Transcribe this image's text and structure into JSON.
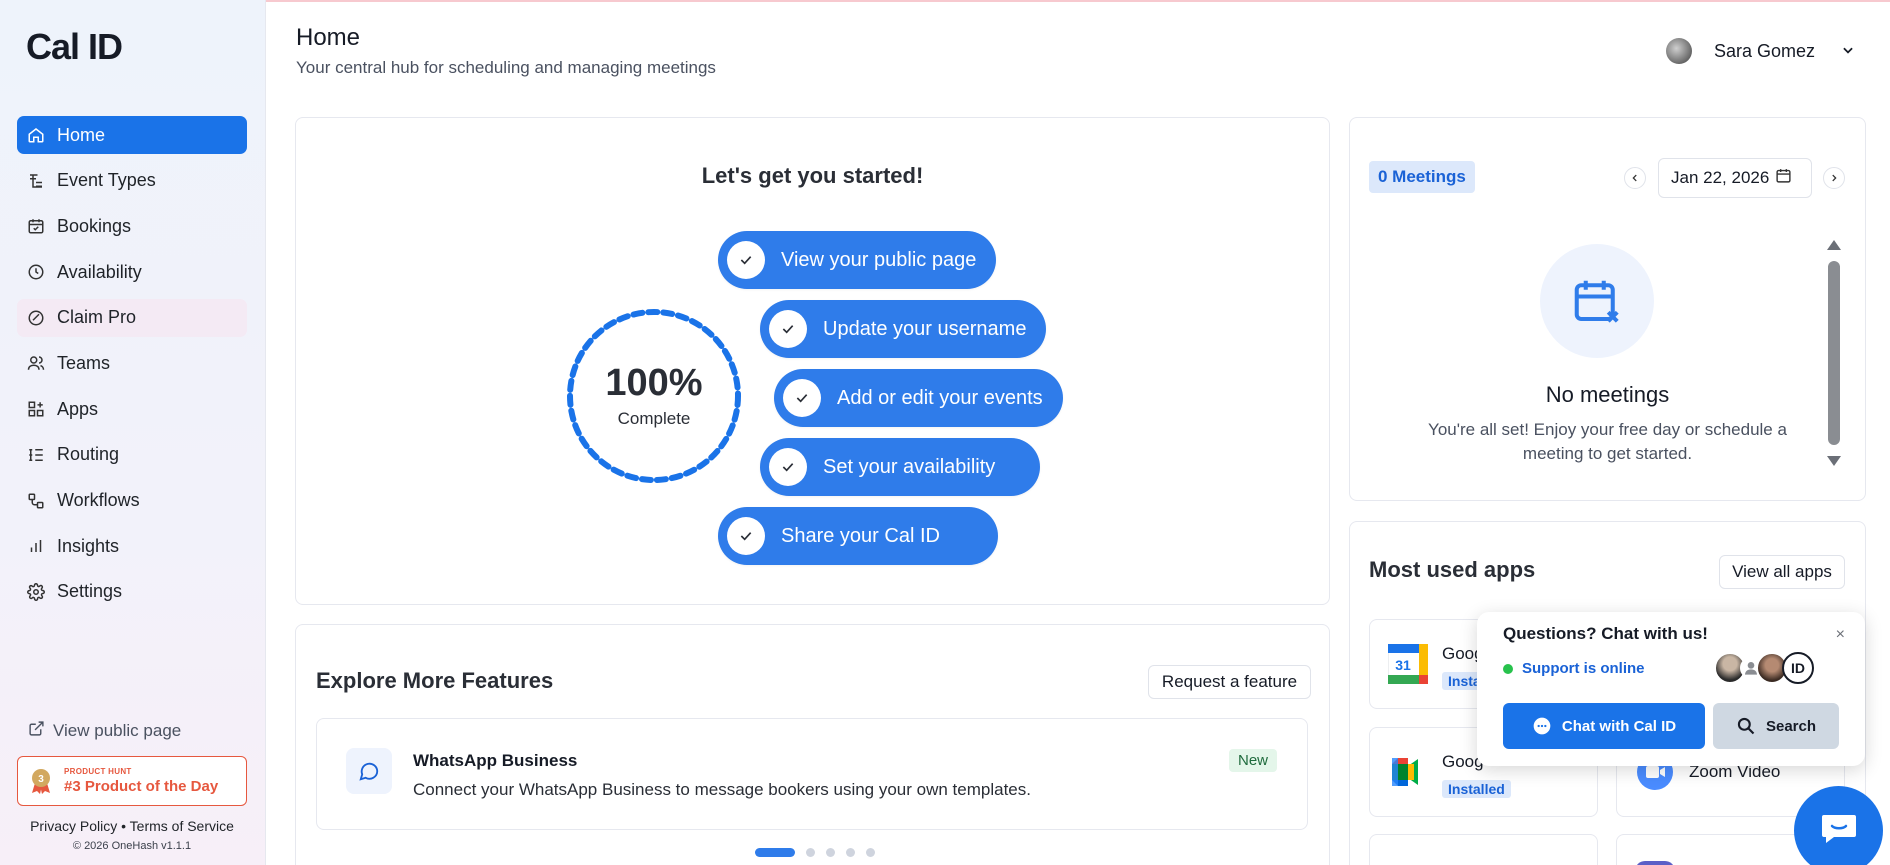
{
  "app": {
    "logo": "Cal ID"
  },
  "sidebar": {
    "items": [
      {
        "label": "Home",
        "icon": "home-icon"
      },
      {
        "label": "Event Types",
        "icon": "event-types-icon"
      },
      {
        "label": "Bookings",
        "icon": "calendar-check-icon"
      },
      {
        "label": "Availability",
        "icon": "clock-icon"
      },
      {
        "label": "Claim Pro",
        "icon": "badge-icon"
      },
      {
        "label": "Teams",
        "icon": "users-icon"
      },
      {
        "label": "Apps",
        "icon": "grid-plus-icon"
      },
      {
        "label": "Routing",
        "icon": "list-tree-icon"
      },
      {
        "label": "Workflows",
        "icon": "workflow-icon"
      },
      {
        "label": "Insights",
        "icon": "bar-chart-icon"
      },
      {
        "label": "Settings",
        "icon": "gear-icon"
      }
    ],
    "view_public_page": "View public page",
    "product_hunt": {
      "kicker": "PRODUCT HUNT",
      "rank": "#3 Product of the Day"
    },
    "privacy": "Privacy Policy",
    "separator": "•",
    "terms": "Terms of Service",
    "copyright": "© 2026 OneHash v1.1.1"
  },
  "header": {
    "title": "Home",
    "subtitle": "Your central hub for scheduling and managing meetings",
    "user_name": "Sara Gomez"
  },
  "getting_started": {
    "title": "Let's get you started!",
    "progress_percent": 100,
    "progress_label": "100%",
    "complete_label": "Complete",
    "steps": [
      "View your public page",
      "Update your username",
      "Add or edit your events",
      "Set your availability",
      "Share your Cal ID"
    ]
  },
  "explore": {
    "title": "Explore More Features",
    "request_button": "Request a feature",
    "feature": {
      "name": "WhatsApp Business",
      "description": "Connect your WhatsApp Business to message bookers using your own templates.",
      "badge": "New"
    },
    "carousel_active_index": 0,
    "carousel_count": 5
  },
  "meetings": {
    "count_label": "0 Meetings",
    "date": "Jan 22, 2026",
    "empty_title": "No meetings",
    "empty_text": "You're all set! Enjoy your free day or schedule a meeting to get started."
  },
  "apps": {
    "title": "Most used apps",
    "view_all": "View all apps",
    "tiles": [
      {
        "name": "Goog",
        "status": "Installed"
      },
      {
        "name": "Goog",
        "status": "Installed"
      },
      {
        "name": "Zoom Video",
        "status": ""
      }
    ]
  },
  "chat": {
    "title": "Questions? Chat with us!",
    "status": "Support is online",
    "primary_button": "Chat with Cal ID",
    "secondary_button": "Search",
    "close": "×"
  },
  "colors": {
    "accent": "#1a73e8",
    "step_blue": "#2f7cea",
    "product_hunt": "#e6583f",
    "online": "#27c24c"
  }
}
